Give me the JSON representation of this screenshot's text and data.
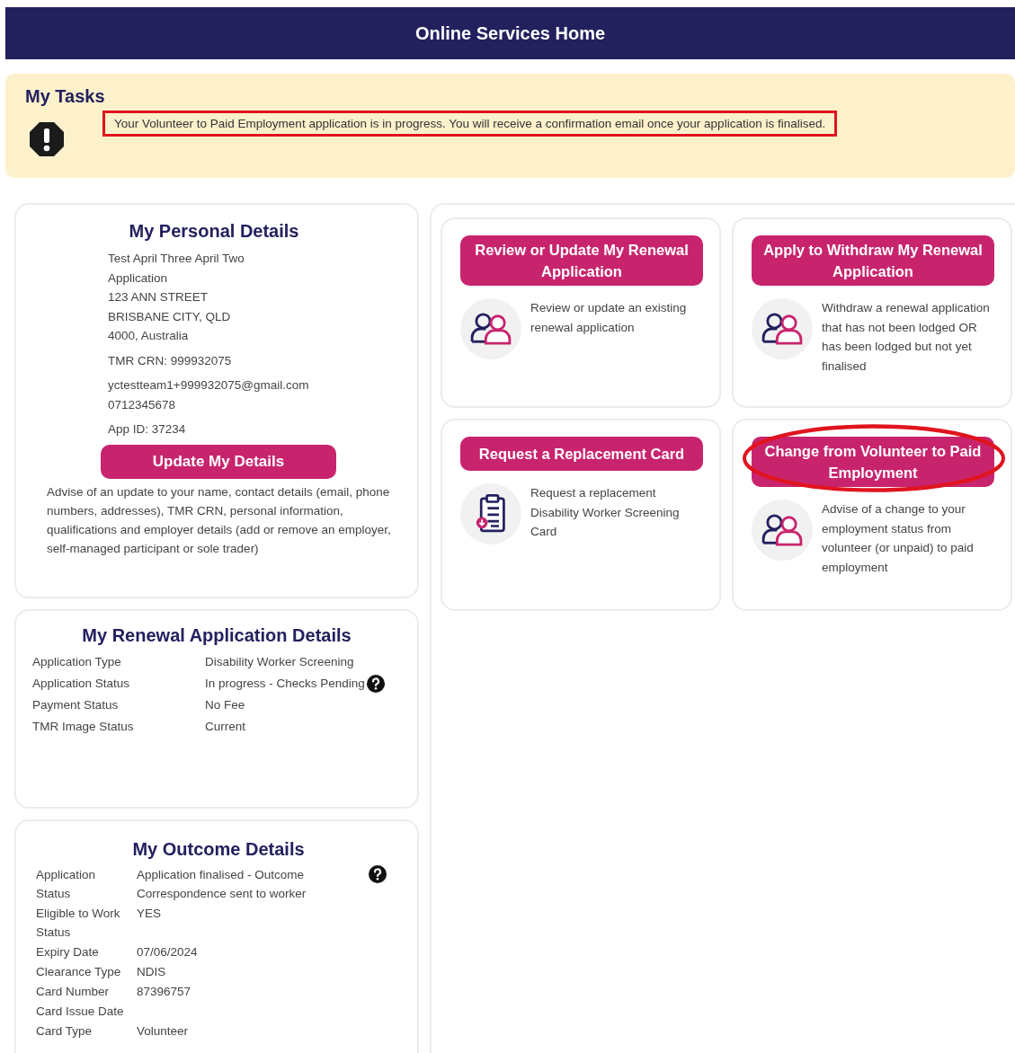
{
  "header": {
    "title": "Online Services Home"
  },
  "tasks": {
    "title": "My Tasks",
    "message": "Your Volunteer to Paid Employment application is in progress. You will receive a confirmation email once your application is finalised.",
    "annotated": true
  },
  "personal": {
    "title": "My Personal Details",
    "groups": [
      [
        "Test April Three April Two",
        "Application",
        "123 ANN STREET",
        "BRISBANE CITY, QLD",
        "4000, Australia"
      ],
      [
        "TMR CRN: 999932075"
      ],
      [
        "yctestteam1+999932075@gmail.com",
        "0712345678"
      ],
      [
        "App ID: 37234"
      ]
    ],
    "button": "Update My Details",
    "description": "Advise of an update to your name, contact details (email, phone numbers, addresses), TMR CRN, personal information, qualifications and employer details (add or remove an employer, self-managed participant or sole trader)"
  },
  "renewal": {
    "title": "My Renewal Application Details",
    "rows": [
      {
        "label": "Application Type",
        "value": "Disability Worker Screening"
      },
      {
        "label": "Application Status",
        "value": "In progress - Checks Pending",
        "help": true
      },
      {
        "label": "Payment Status",
        "value": "No Fee"
      },
      {
        "label": "TMR Image Status",
        "value": "Current"
      }
    ]
  },
  "outcome": {
    "title": "My Outcome Details",
    "rows": [
      {
        "label": "Application Status",
        "value": "Application finalised - Outcome Correspondence sent to worker",
        "help": true
      },
      {
        "label": "Eligible to Work Status",
        "value": "YES"
      },
      {
        "label": "Expiry Date",
        "value": "07/06/2024"
      },
      {
        "label": "Clearance Type",
        "value": "NDIS"
      },
      {
        "label": "Card Number",
        "value": "87396757"
      },
      {
        "label": "Card Issue Date"
      },
      {
        "label": "Card Type",
        "value": "Volunteer"
      }
    ]
  },
  "tiles": [
    {
      "button": "Review or Update My Renewal Application",
      "kind": "people",
      "description": "Review or update an existing renewal application",
      "annotated": false
    },
    {
      "button": "Apply to Withdraw My Renewal Application",
      "kind": "people",
      "description": "Withdraw a renewal application that has not been lodged OR has been lodged but not yet finalised",
      "annotated": false
    },
    {
      "button": "Request a Replacement Card",
      "kind": "clipboard",
      "description": "Request a replacement Disability Worker Screening Card",
      "annotated": false
    },
    {
      "button": "Change from Volunteer to Paid Employment",
      "kind": "people",
      "description": "Advise of a change to your employment status from volunteer (or unpaid) to paid employment",
      "annotated": true
    }
  ]
}
